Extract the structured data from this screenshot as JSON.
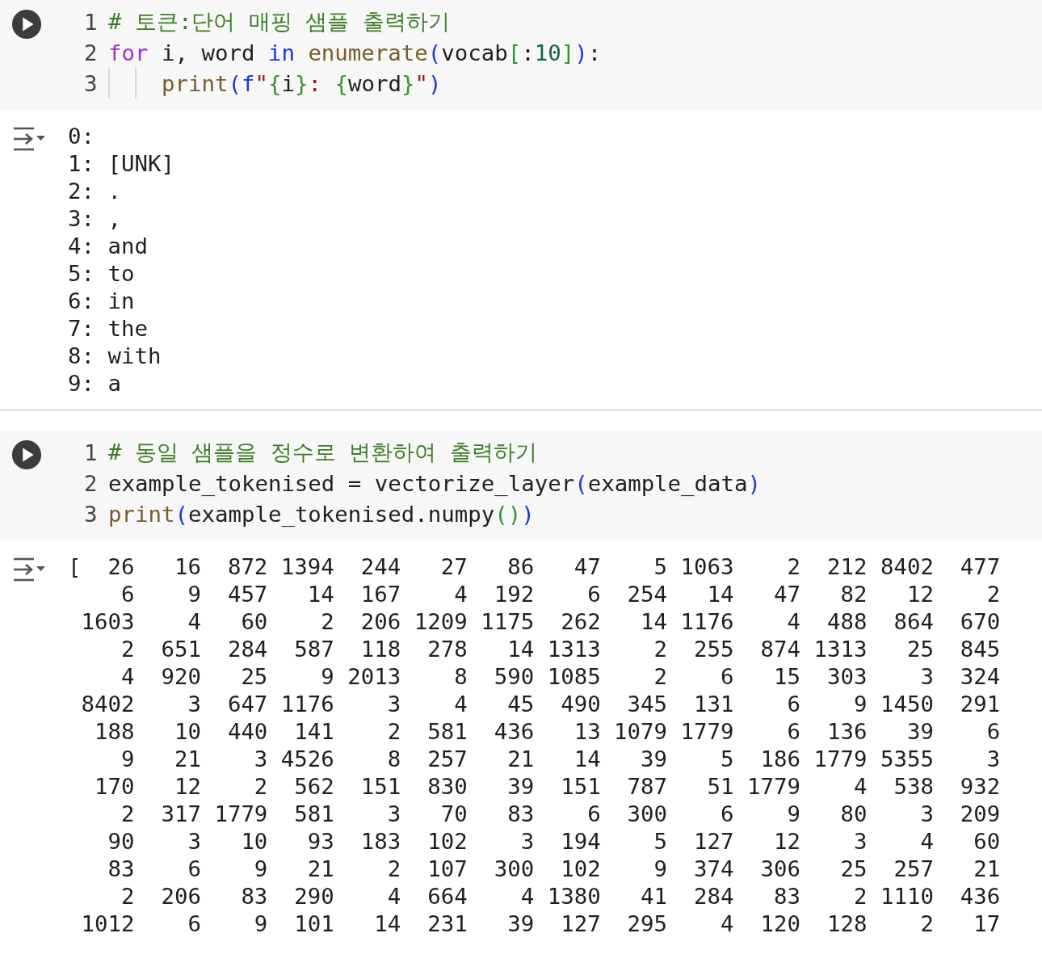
{
  "cells": [
    {
      "code": [
        {
          "number": "1",
          "tokens": [
            {
              "kind": "comment",
              "text": "# 토큰:단어 매핑 샘플 출력하기"
            }
          ]
        },
        {
          "number": "2",
          "tokens": [
            {
              "kind": "control",
              "text": "for"
            },
            {
              "kind": "plain",
              "text": " i, word "
            },
            {
              "kind": "keyword",
              "text": "in"
            },
            {
              "kind": "function",
              "text": " enumerate"
            },
            {
              "kind": "bracket1",
              "text": "("
            },
            {
              "kind": "plain",
              "text": "vocab"
            },
            {
              "kind": "bracket2",
              "text": "["
            },
            {
              "kind": "plain",
              "text": ":"
            },
            {
              "kind": "number",
              "text": "10"
            },
            {
              "kind": "bracket2",
              "text": "]"
            },
            {
              "kind": "bracket1",
              "text": ")"
            },
            {
              "kind": "plain",
              "text": ":"
            }
          ]
        },
        {
          "number": "3",
          "indent": true,
          "tokens": [
            {
              "kind": "function",
              "text": "print"
            },
            {
              "kind": "bracket1",
              "text": "("
            },
            {
              "kind": "keyword",
              "text": "f"
            },
            {
              "kind": "string",
              "text": "\""
            },
            {
              "kind": "bracket2",
              "text": "{"
            },
            {
              "kind": "plain",
              "text": "i"
            },
            {
              "kind": "bracket2",
              "text": "}"
            },
            {
              "kind": "string",
              "text": ": "
            },
            {
              "kind": "bracket2",
              "text": "{"
            },
            {
              "kind": "plain",
              "text": "word"
            },
            {
              "kind": "bracket2",
              "text": "}"
            },
            {
              "kind": "string",
              "text": "\""
            },
            {
              "kind": "bracket1",
              "text": ")"
            }
          ]
        }
      ],
      "output": {
        "kind": "lines",
        "lines": [
          "0:",
          "1: [UNK]",
          "2: .",
          "3: ,",
          "4: and",
          "5: to",
          "6: in",
          "7: the",
          "8: with",
          "9: a"
        ]
      }
    },
    {
      "code": [
        {
          "number": "1",
          "tokens": [
            {
              "kind": "comment",
              "text": "# 동일 샘플을 정수로 변환하여 출력하기"
            }
          ]
        },
        {
          "number": "2",
          "tokens": [
            {
              "kind": "plain",
              "text": "example_tokenised = vectorize_layer"
            },
            {
              "kind": "bracket1",
              "text": "("
            },
            {
              "kind": "plain",
              "text": "example_data"
            },
            {
              "kind": "bracket1",
              "text": ")"
            }
          ]
        },
        {
          "number": "3",
          "tokens": [
            {
              "kind": "function",
              "text": "print"
            },
            {
              "kind": "bracket1",
              "text": "("
            },
            {
              "kind": "plain",
              "text": "example_tokenised.numpy"
            },
            {
              "kind": "bracket2",
              "text": "()"
            },
            {
              "kind": "bracket1",
              "text": ")"
            }
          ]
        }
      ],
      "output": {
        "kind": "array",
        "open": "[",
        "rows": [
          [
            "26",
            "16",
            "872",
            "1394",
            "244",
            "27",
            "86",
            "47",
            "5",
            "1063",
            "2",
            "212",
            "8402",
            "477"
          ],
          [
            "6",
            "9",
            "457",
            "14",
            "167",
            "4",
            "192",
            "6",
            "254",
            "14",
            "47",
            "82",
            "12",
            "2"
          ],
          [
            "1603",
            "4",
            "60",
            "2",
            "206",
            "1209",
            "1175",
            "262",
            "14",
            "1176",
            "4",
            "488",
            "864",
            "670"
          ],
          [
            "2",
            "651",
            "284",
            "587",
            "118",
            "278",
            "14",
            "1313",
            "2",
            "255",
            "874",
            "1313",
            "25",
            "845"
          ],
          [
            "4",
            "920",
            "25",
            "9",
            "2013",
            "8",
            "590",
            "1085",
            "2",
            "6",
            "15",
            "303",
            "3",
            "324"
          ],
          [
            "8402",
            "3",
            "647",
            "1176",
            "3",
            "4",
            "45",
            "490",
            "345",
            "131",
            "6",
            "9",
            "1450",
            "291"
          ],
          [
            "188",
            "10",
            "440",
            "141",
            "2",
            "581",
            "436",
            "13",
            "1079",
            "1779",
            "6",
            "136",
            "39",
            "6"
          ],
          [
            "9",
            "21",
            "3",
            "4526",
            "8",
            "257",
            "21",
            "14",
            "39",
            "5",
            "186",
            "1779",
            "5355",
            "3"
          ],
          [
            "170",
            "12",
            "2",
            "562",
            "151",
            "830",
            "39",
            "151",
            "787",
            "51",
            "1779",
            "4",
            "538",
            "932"
          ],
          [
            "2",
            "317",
            "1779",
            "581",
            "3",
            "70",
            "83",
            "6",
            "300",
            "6",
            "9",
            "80",
            "3",
            "209"
          ],
          [
            "90",
            "3",
            "10",
            "93",
            "183",
            "102",
            "3",
            "194",
            "5",
            "127",
            "12",
            "3",
            "4",
            "60"
          ],
          [
            "83",
            "6",
            "9",
            "21",
            "2",
            "107",
            "300",
            "102",
            "9",
            "374",
            "306",
            "25",
            "257",
            "21"
          ],
          [
            "2",
            "206",
            "83",
            "290",
            "4",
            "664",
            "4",
            "1380",
            "41",
            "284",
            "83",
            "2",
            "1110",
            "436"
          ],
          [
            "1012",
            "6",
            "9",
            "101",
            "14",
            "231",
            "39",
            "127",
            "295",
            "4",
            "120",
            "128",
            "2",
            "17"
          ]
        ]
      }
    }
  ]
}
